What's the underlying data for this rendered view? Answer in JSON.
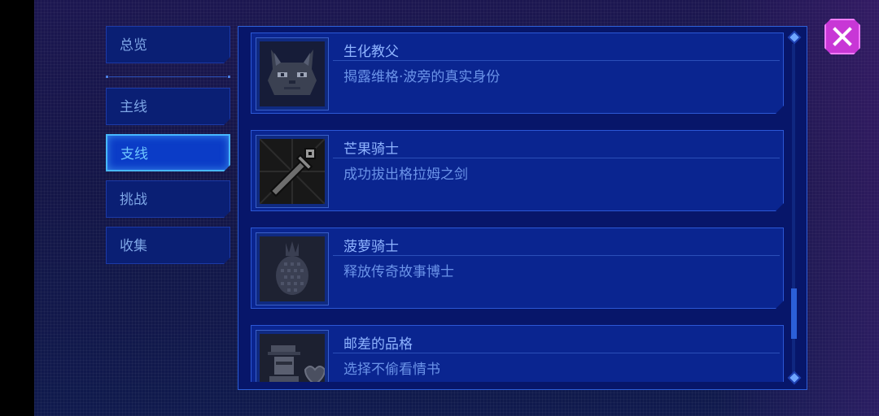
{
  "sidebar": {
    "items": [
      {
        "label": "总览"
      },
      {
        "label": "主线"
      },
      {
        "label": "支线",
        "active": true
      },
      {
        "label": "挑战"
      },
      {
        "label": "收集"
      }
    ]
  },
  "achievements": [
    {
      "title": "生化教父",
      "description": "揭露维格·波旁的真实身份",
      "icon": "cat-face-icon"
    },
    {
      "title": "芒果骑士",
      "description": "成功拔出格拉姆之剑",
      "icon": "sword-icon"
    },
    {
      "title": "菠萝骑士",
      "description": "释放传奇故事博士",
      "icon": "pineapple-icon"
    },
    {
      "title": "邮差的品格",
      "description": "选择不偷看情书",
      "icon": "postman-heart-icon"
    }
  ],
  "colors": {
    "accent": "#47b8ff",
    "close": "#c837d6",
    "panel": "#0a2590"
  },
  "scroll": {
    "position": 0.75
  }
}
